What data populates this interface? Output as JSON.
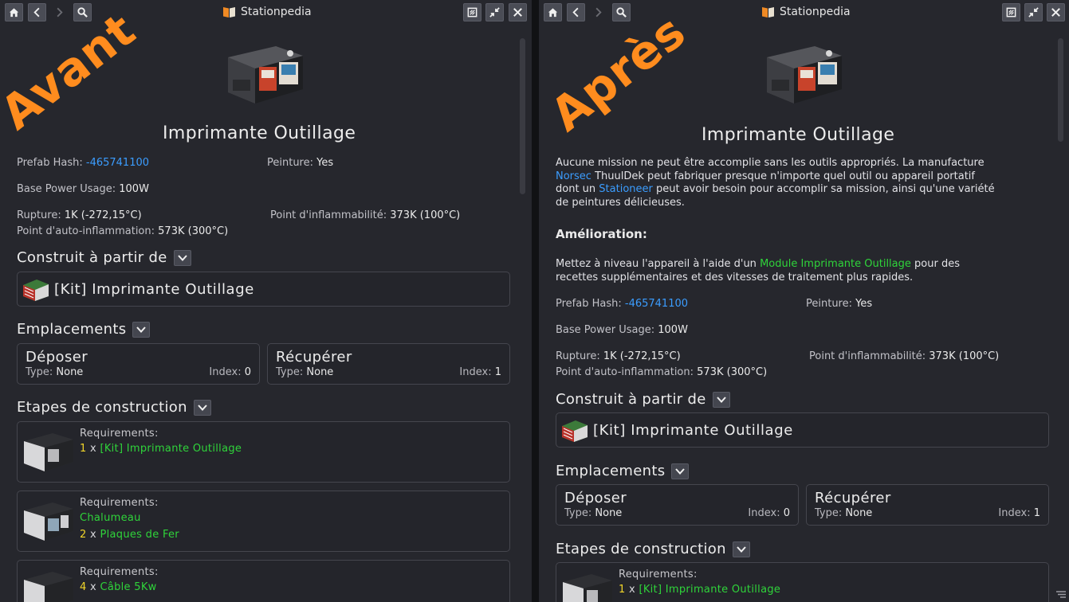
{
  "window": {
    "title": "Stationpedia"
  },
  "labels": {
    "avant": "Avant",
    "apres": "Après"
  },
  "item": {
    "title": "Imprimante Outillage",
    "prefab_hash_label": "Prefab Hash:",
    "prefab_hash_value": "-465741100",
    "paint_label": "Peinture:",
    "paint_value": "Yes",
    "power_label": "Base Power Usage:",
    "power_value": "100W",
    "rupture_label": "Rupture:",
    "rupture_value": "1K (-272,15°C)",
    "flash_label": "Point d'inflammabilité:",
    "flash_value": "373K (100°C)",
    "autoign_label": "Point d'auto-inflammation:",
    "autoign_value": "573K (300°C)"
  },
  "description": {
    "p1": "Aucune mission ne peut être accomplie sans les outils appropriés. La manufacture",
    "link1": "Norsec",
    "p2": " ThuulDek peut fabriquer presque n'importe quel outil ou appareil portatif",
    "p3": "dont un ",
    "link2": "Stationeer",
    "p4": " peut avoir besoin pour accomplir sa mission, ainsi qu'une variété",
    "p5": "de peintures délicieuses.",
    "upgrade_heading": "Amélioration:",
    "u1": "Mettez à niveau l'appareil à l'aide d'un ",
    "u_link": "Module Imprimante Outillage",
    "u2": " pour des",
    "u3": "recettes supplémentaires et des vitesses de traitement plus rapides."
  },
  "built_from": {
    "heading": "Construit à partir de",
    "kit_label": "[Kit] Imprimante Outillage"
  },
  "slots": {
    "heading": "Emplacements",
    "type_label": "Type:",
    "index_label": "Index:",
    "items": [
      {
        "name": "Déposer",
        "type": "None",
        "index": "0"
      },
      {
        "name": "Récupérer",
        "type": "None",
        "index": "1"
      }
    ]
  },
  "construction": {
    "heading": "Etapes de construction",
    "req_label": "Requirements:",
    "steps": [
      {
        "lines": [
          {
            "qty": "1",
            "x": "x",
            "item": "[Kit] Imprimante Outillage"
          }
        ]
      },
      {
        "tool": "Chalumeau",
        "lines": [
          {
            "qty": "2",
            "x": "x",
            "item": "Plaques de Fer"
          }
        ]
      },
      {
        "lines": [
          {
            "qty": "4",
            "x": "x",
            "item": "Câble 5Kw"
          }
        ]
      }
    ]
  },
  "colors": {
    "link": "#3b9dff",
    "green": "#2fd43a",
    "qty": "#f2d62a",
    "overlay": "#ff8c1e"
  },
  "icons": [
    "home-icon",
    "back-icon",
    "forward-icon",
    "search-icon",
    "book-icon",
    "note-icon",
    "collapse-icon",
    "close-icon",
    "chevron-down-icon"
  ]
}
